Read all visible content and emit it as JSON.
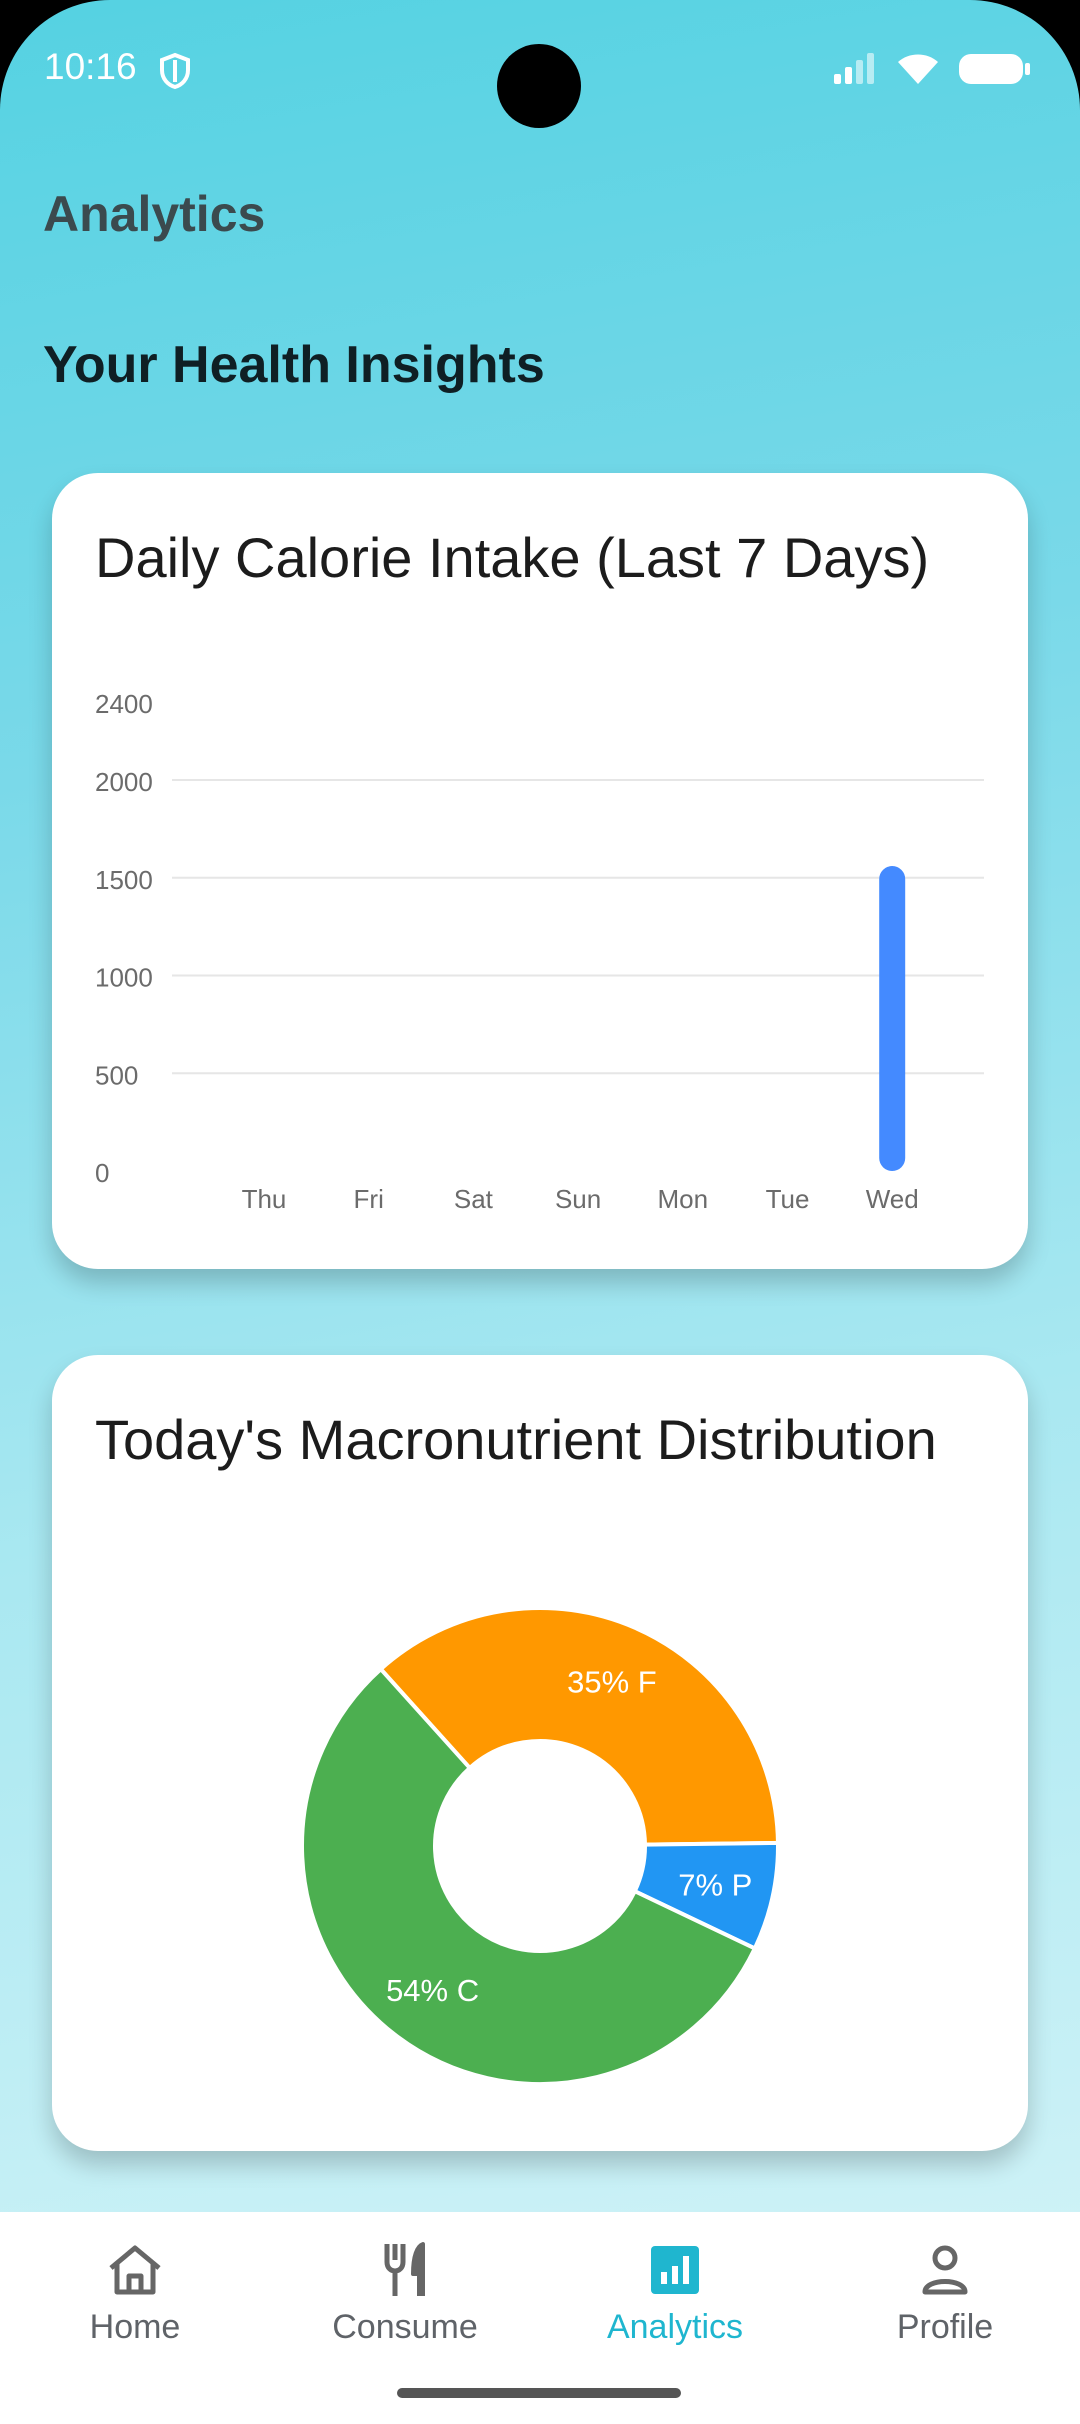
{
  "status_bar": {
    "time": "10:16"
  },
  "page": {
    "title": "Analytics",
    "section_title": "Your Health Insights"
  },
  "calorie_card": {
    "title": "Daily Calorie Intake (Last 7 Days)"
  },
  "macro_card": {
    "title": "Today's Macronutrient Distribution"
  },
  "chart_data": [
    {
      "type": "bar",
      "title": "Daily Calorie Intake (Last 7 Days)",
      "categories": [
        "Thu",
        "Fri",
        "Sat",
        "Sun",
        "Mon",
        "Tue",
        "Wed"
      ],
      "values": [
        0,
        0,
        0,
        0,
        0,
        0,
        1560
      ],
      "y_ticks": [
        "0",
        "500",
        "1000",
        "1500",
        "2000",
        "2400"
      ],
      "ylim": [
        0,
        2400
      ],
      "grid": true,
      "bar_color": "#448aff"
    },
    {
      "type": "pie",
      "title": "Today's Macronutrient Distribution",
      "labels": [
        "35% F",
        "7% P",
        "54% C"
      ],
      "values": [
        35,
        7,
        54
      ],
      "colors": [
        "#ff9800",
        "#2196f3",
        "#4caf50"
      ],
      "donut": true
    }
  ],
  "bottom_nav": {
    "items": [
      {
        "label": "Home",
        "icon": "home-icon"
      },
      {
        "label": "Consume",
        "icon": "fork-knife-icon"
      },
      {
        "label": "Analytics",
        "icon": "analytics-icon"
      },
      {
        "label": "Profile",
        "icon": "person-icon"
      }
    ],
    "active": "Analytics",
    "active_color": "#1fb6cf"
  }
}
